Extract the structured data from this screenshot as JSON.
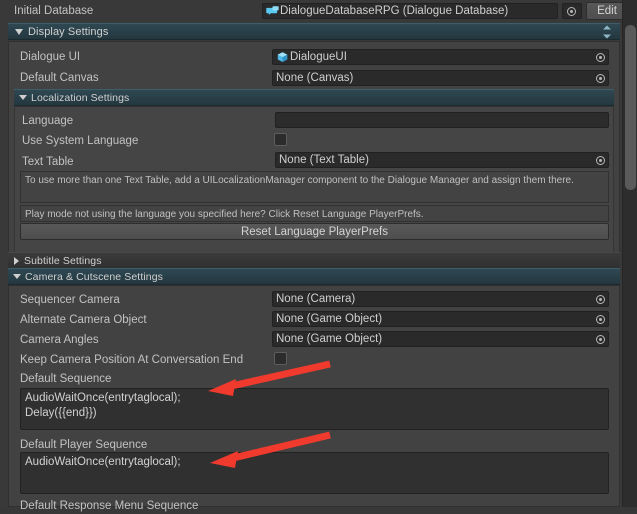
{
  "window": {
    "accent_teal": "#2e4852",
    "background": "#393939",
    "annotation_color": "#f03a2e"
  },
  "initial_database": {
    "label": "Initial Database",
    "value": "DialogueDatabaseRPG (Dialogue Database)",
    "icon": "dialogue-database-icon",
    "picker_icon": "object-picker-icon",
    "edit_label": "Edit"
  },
  "display_settings": {
    "label": "Display Settings",
    "expanded": true,
    "fields": [
      {
        "label": "Dialogue UI",
        "value": "DialogueUI",
        "icon": "prefab-cube-icon"
      },
      {
        "label": "Default Canvas",
        "value": "None (Canvas)",
        "icon": "none"
      }
    ]
  },
  "localization_settings": {
    "label": "Localization Settings",
    "expanded": true,
    "language": {
      "label": "Language",
      "value": "",
      "placeholder": ""
    },
    "use_system_language": {
      "label": "Use System Language",
      "checked": false
    },
    "text_table": {
      "label": "Text Table",
      "value": "None (Text Table)"
    },
    "help_1": "To use more than one Text Table, add a UILocalizationManager component to the Dialogue Manager and assign them there.",
    "help_2": "Play mode not using the language you specified here? Click Reset Language PlayerPrefs.",
    "reset_button": "Reset Language PlayerPrefs"
  },
  "subtitle_settings": {
    "label": "Subtitle Settings",
    "expanded": false
  },
  "camera_cutscene_settings": {
    "label": "Camera & Cutscene Settings",
    "expanded": true,
    "fields": [
      {
        "label": "Sequencer Camera",
        "value": "None (Camera)"
      },
      {
        "label": "Alternate Camera Object",
        "value": "None (Game Object)"
      },
      {
        "label": "Camera Angles",
        "value": "None (Game Object)"
      }
    ],
    "keep_camera_position": {
      "label": "Keep Camera Position At Conversation End",
      "checked": false
    },
    "default_sequence": {
      "label": "Default Sequence",
      "value": "AudioWaitOnce(entrytaglocal);\nDelay({{end}})"
    },
    "default_player_sequence": {
      "label": "Default Player Sequence",
      "value": "AudioWaitOnce(entrytaglocal);"
    },
    "default_response_menu_sequence": {
      "label": "Default Response Menu Sequence"
    }
  },
  "scrollbar": {
    "name": "vertical-scrollbar"
  }
}
